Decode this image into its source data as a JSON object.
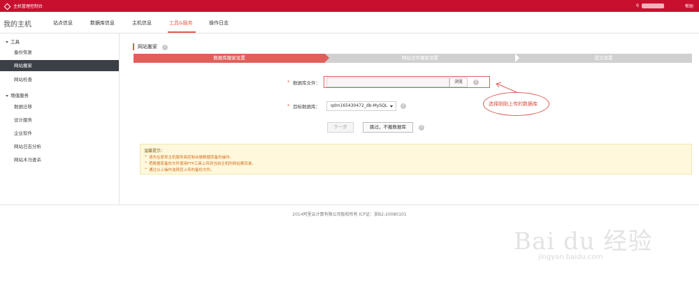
{
  "topbar": {
    "app_title": "主机管理控制台",
    "user_prefix": "q",
    "help": "帮助"
  },
  "subnav": {
    "home": "我的主机",
    "tabs": [
      {
        "label": "站点信息",
        "active": false
      },
      {
        "label": "数据库信息",
        "active": false
      },
      {
        "label": "主机信息",
        "active": false
      },
      {
        "label": "工具&服务",
        "active": true
      },
      {
        "label": "操作日志",
        "active": false
      }
    ]
  },
  "sidebar": {
    "sections": [
      {
        "title": "工具",
        "items": [
          "备份恢复",
          "网站搬家",
          "网站检查"
        ]
      },
      {
        "title": "增值服务",
        "items": [
          "数据迁移",
          "设计服务",
          "企业软件",
          "网站日志分析",
          "网站木马查杀"
        ]
      }
    ],
    "active_item": "网站搬家"
  },
  "main": {
    "title": "网站搬家",
    "steps": [
      "数据库搬家设置",
      "网站文件搬家设置",
      "提交设置"
    ],
    "current_step": 1,
    "form": {
      "db_file_label": "数据库文件：",
      "db_file_value": "",
      "browse_label": "浏览",
      "target_db_label": "目标数据库：",
      "target_db_value": "qdm165430472_db-MySQL",
      "next_label": "下一步",
      "skip_label": "跳过，不搬数据库"
    },
    "annotation": "选择刚刚上传的数据库",
    "notice": {
      "title": "温馨提示：",
      "items": [
        "请先在原来主机服务商控制台做数据库备份操作。",
        "把数据库备份文件使用FTP工具上传到当前主机的网站根目录。",
        "通过以上操作选择您上传的备份文件。"
      ]
    }
  },
  "footer": {
    "copyright": "2014阿里云计算有限公司版权所有 ICP证：浙B2-20080101"
  },
  "watermark": {
    "main": "Bai du 经验",
    "sub": "jingyan.baidu.com"
  },
  "colors": {
    "brand_red": "#c8102e",
    "accent": "#e25b4a",
    "step_active": "#e15f5a",
    "step_inactive": "#d0d0d0"
  }
}
